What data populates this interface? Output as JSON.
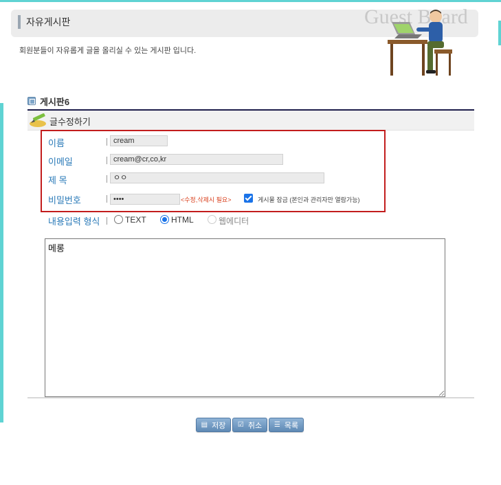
{
  "header": {
    "title": "자유게시판",
    "watermark": "Guest Board",
    "intro": "회원분들이 자유롭게 글을 올리실 수 있는 게시판 입니다."
  },
  "board": {
    "name": "게시판6",
    "section_title": "글수정하기"
  },
  "form": {
    "name_label": "이름",
    "name_value": "cream",
    "email_label": "이메일",
    "email_value": "cream@cr,co,kr",
    "subject_label": "제 목",
    "subject_value": "ㅇㅇ",
    "password_label": "비밀번호",
    "password_value": "••••",
    "password_note": "<수정,삭제시 필요>",
    "secret_checked": true,
    "secret_label": "게시물 잠금 (본인과 관리자만 열람가능)",
    "format_label": "내용입력 형식",
    "format_options": [
      "TEXT",
      "HTML",
      "웹에디터"
    ],
    "format_selected": "HTML",
    "content": "메롱"
  },
  "buttons": {
    "save": "저장",
    "cancel": "취소",
    "list": "목록"
  },
  "colors": {
    "accent_teal": "#5fd3d3",
    "label_blue": "#2a7ab8",
    "highlight_red": "#c21c1c",
    "button_blue": "#5f8ab5"
  }
}
